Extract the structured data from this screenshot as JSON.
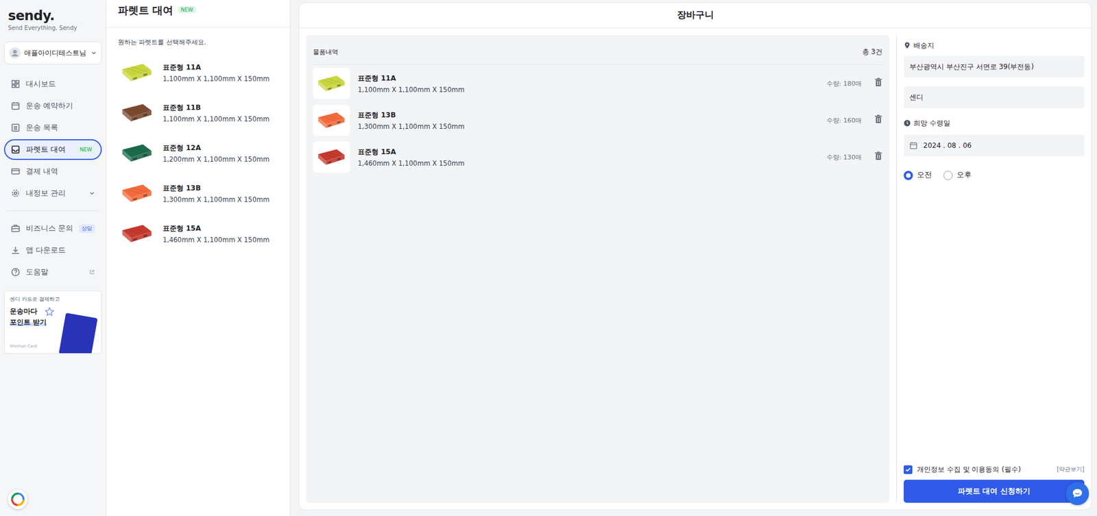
{
  "logo": {
    "name": "sendy.",
    "tagline": "Send Everything, Sendy"
  },
  "account": {
    "name": "애플아이디테스트님"
  },
  "nav": [
    {
      "label": "대시보드",
      "selected": false,
      "icon": "dashboard"
    },
    {
      "label": "운송 예약하기",
      "selected": false,
      "icon": "calendar"
    },
    {
      "label": "운송 목록",
      "selected": false,
      "icon": "list"
    },
    {
      "label": "파렛트 대여",
      "selected": true,
      "icon": "inbox",
      "badge": "NEW"
    },
    {
      "label": "결제 내역",
      "selected": false,
      "icon": "card"
    },
    {
      "label": "내정보 관리",
      "selected": false,
      "icon": "gear",
      "expandable": true,
      "expanded": false
    }
  ],
  "nav2": [
    {
      "label": "비즈니스 문의",
      "icon": "briefcase",
      "badge": "상담"
    },
    {
      "label": "앱 다운로드",
      "icon": "download"
    },
    {
      "label": "도움말",
      "icon": "help",
      "external": true
    }
  ],
  "promo": {
    "line1": "센디 카드로 결제하고",
    "line2": "운송마다",
    "line3": "포인트 받기",
    "brand": "Shinhan Card"
  },
  "pallet_panel": {
    "title": "파렛트 대여",
    "badge": "NEW",
    "instruction": "원하는 파렛트를 선택해주세요.",
    "items": [
      {
        "name": "표준형 11A",
        "size": "1,100mm X 1,100mm X 150mm",
        "color": "#c9d53c"
      },
      {
        "name": "표준형 11B",
        "size": "1,100mm X 1,100mm X 150mm",
        "color": "#7b4a31"
      },
      {
        "name": "표준형 12A",
        "size": "1,200mm X 1,100mm X 150mm",
        "color": "#1c6a4d"
      },
      {
        "name": "표준형 13B",
        "size": "1,300mm X 1,100mm X 150mm",
        "color": "#f36b3b"
      },
      {
        "name": "표준형 15A",
        "size": "1,460mm X 1,100mm X 150mm",
        "color": "#c53a2e"
      }
    ]
  },
  "cart": {
    "title": "장바구니",
    "list_label": "물품내역",
    "count": "총 3건",
    "items": [
      {
        "name": "표준형 11A",
        "size": "1,100mm X 1,100mm X 150mm",
        "qty": "수량: 180매",
        "color": "#c9d53c"
      },
      {
        "name": "표준형 13B",
        "size": "1,300mm X 1,100mm X 150mm",
        "qty": "수량: 160매",
        "color": "#f36b3b"
      },
      {
        "name": "표준형 15A",
        "size": "1,460mm X 1,100mm X 150mm",
        "qty": "수량: 130매",
        "color": "#c53a2e"
      }
    ]
  },
  "form": {
    "address_label": "배송지",
    "address": "부산광역시 부산진구 서면로 39(부전동)",
    "recipient": "센디",
    "date_label": "희망 수령일",
    "date": "2024 . 08 . 06",
    "times": [
      {
        "label": "오전",
        "selected": true
      },
      {
        "label": "오후",
        "selected": false
      }
    ],
    "agree": {
      "label": "개인정보 수집 및 이용동의 (필수)",
      "checked": true,
      "link": "[약관보기]"
    },
    "submit": "파렛트 대여 신청하기"
  }
}
